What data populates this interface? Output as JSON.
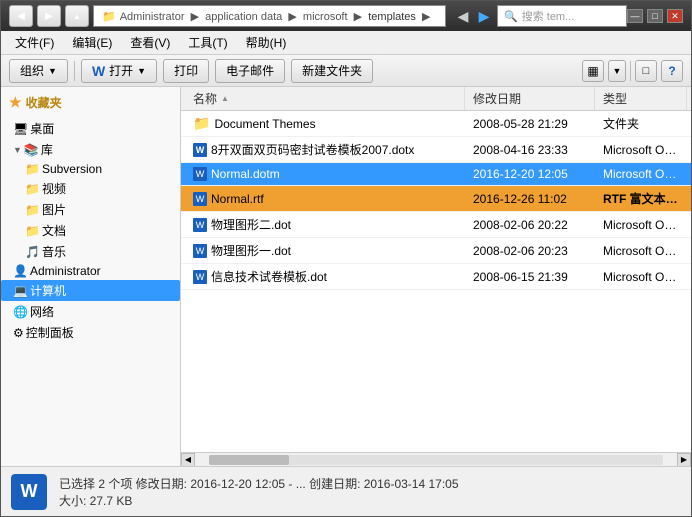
{
  "window": {
    "title": "templates",
    "controls": {
      "minimize": "—",
      "maximize": "□",
      "close": "✕"
    }
  },
  "navbar": {
    "back": "◀",
    "forward": "▶",
    "up": "▲",
    "address_parts": [
      "Administrator",
      "application data",
      "microsoft",
      "templates"
    ],
    "search_placeholder": "搜索 tem...",
    "search_icon": "🔍"
  },
  "menubar": {
    "items": [
      {
        "label": "文件(F)"
      },
      {
        "label": "编辑(E)"
      },
      {
        "label": "查看(V)"
      },
      {
        "label": "工具(T)"
      },
      {
        "label": "帮助(H)"
      }
    ]
  },
  "toolbar": {
    "organize_label": "组织",
    "open_label": "打开",
    "print_label": "打印",
    "email_label": "电子邮件",
    "new_folder_label": "新建文件夹",
    "view_icon": "▦",
    "help_icon": "?"
  },
  "sidebar": {
    "favorites_label": "收藏夹",
    "items": [
      {
        "id": "desktop",
        "label": "桌面",
        "icon": "🖥"
      },
      {
        "id": "library",
        "label": "库",
        "icon": "📚"
      },
      {
        "id": "subversion",
        "label": "Subversion",
        "icon": "📁"
      },
      {
        "id": "video",
        "label": "视频",
        "icon": "📁"
      },
      {
        "id": "pictures",
        "label": "图片",
        "icon": "📁"
      },
      {
        "id": "documents",
        "label": "文档",
        "icon": "📁"
      },
      {
        "id": "music",
        "label": "音乐",
        "icon": "🎵"
      },
      {
        "id": "administrator",
        "label": "Administrator",
        "icon": "👤"
      },
      {
        "id": "computer",
        "label": "计算机",
        "icon": "💻",
        "active": true
      },
      {
        "id": "network",
        "label": "网络",
        "icon": "🌐"
      },
      {
        "id": "control-panel",
        "label": "控制面板",
        "icon": "⚙"
      }
    ]
  },
  "filelist": {
    "columns": [
      {
        "id": "name",
        "label": "名称"
      },
      {
        "id": "date",
        "label": "修改日期"
      },
      {
        "id": "type",
        "label": "类型"
      }
    ],
    "files": [
      {
        "id": "document-themes",
        "name": "Document Themes",
        "date": "2008-05-28 21:29",
        "type": "文件夹",
        "icon": "folder",
        "selected": false
      },
      {
        "id": "8kai",
        "name": "8开双面双页码密封试卷模板2007.dotx",
        "date": "2008-04-16 23:33",
        "type": "Microsoft Offi...",
        "icon": "doc",
        "selected": false
      },
      {
        "id": "normal-dotm",
        "name": "Normal.dotm",
        "date": "2016-12-20 12:05",
        "type": "Microsoft Offi...",
        "icon": "doc",
        "selected": true,
        "selected_class": "selected2"
      },
      {
        "id": "normal-rtf",
        "name": "Normal.rtf",
        "date": "2016-12-26 11:02",
        "type": "RTF 富文本格式",
        "icon": "doc",
        "selected": true,
        "selected_class": "selected"
      },
      {
        "id": "wuli2",
        "name": "物理图形二.dot",
        "date": "2008-02-06 20:22",
        "type": "Microsoft Offi...",
        "icon": "doc",
        "selected": false
      },
      {
        "id": "wuli1",
        "name": "物理图形一.dot",
        "date": "2008-02-06 20:23",
        "type": "Microsoft Offi...",
        "icon": "doc",
        "selected": false
      },
      {
        "id": "xinxi",
        "name": "信息技术试卷模板.dot",
        "date": "2008-06-15 21:39",
        "type": "Microsoft Offi...",
        "icon": "doc",
        "selected": false
      }
    ]
  },
  "statusbar": {
    "icon": "W",
    "text1": "已选择 2 个项  修改日期: 2016-12-20 12:05 - ...  创建日期: 2016-03-14 17:05",
    "text2": "大小: 27.7 KB"
  }
}
